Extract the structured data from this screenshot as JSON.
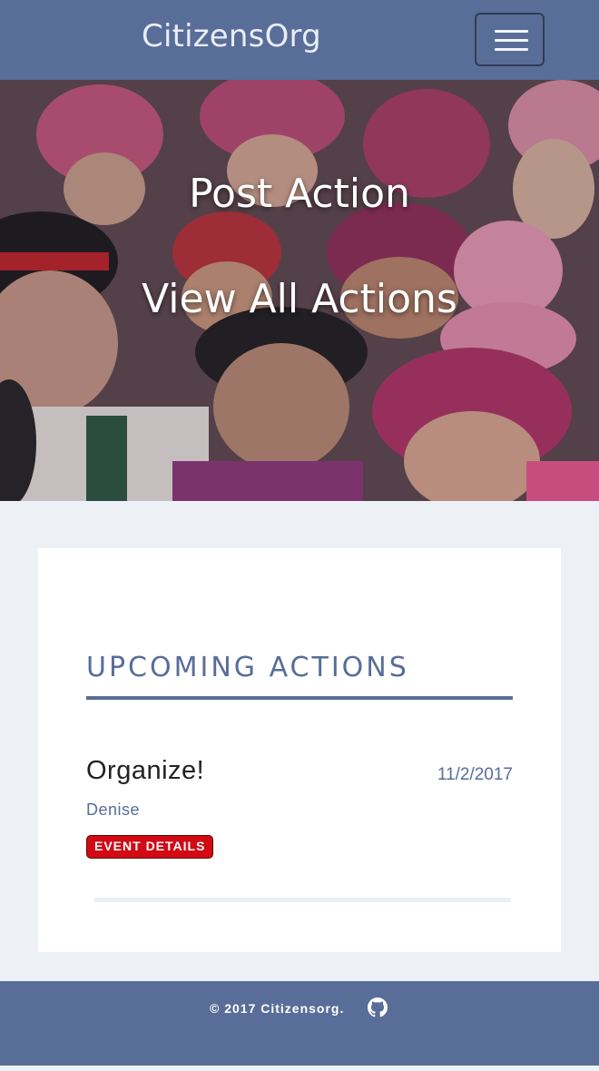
{
  "navbar": {
    "brand": "CitizensOrg",
    "menu_icon": "hamburger-menu-icon"
  },
  "hero": {
    "post_action_label": "Post Action",
    "view_all_label": "View All Actions",
    "background": "crowd-photo-pink-hats"
  },
  "upcoming": {
    "title": "UPCOMING ACTIONS",
    "items": [
      {
        "title": "Organize!",
        "date": "11/2/2017",
        "author": "Denise",
        "details_label": "EVENT DETAILS"
      }
    ]
  },
  "footer": {
    "copyright": "© 2017 Citizensorg.",
    "github_icon": "github-icon"
  },
  "colors": {
    "primary": "#586d98",
    "page_bg": "#edf1f5",
    "card_bg": "#ffffff",
    "button_red": "#d20a14"
  }
}
